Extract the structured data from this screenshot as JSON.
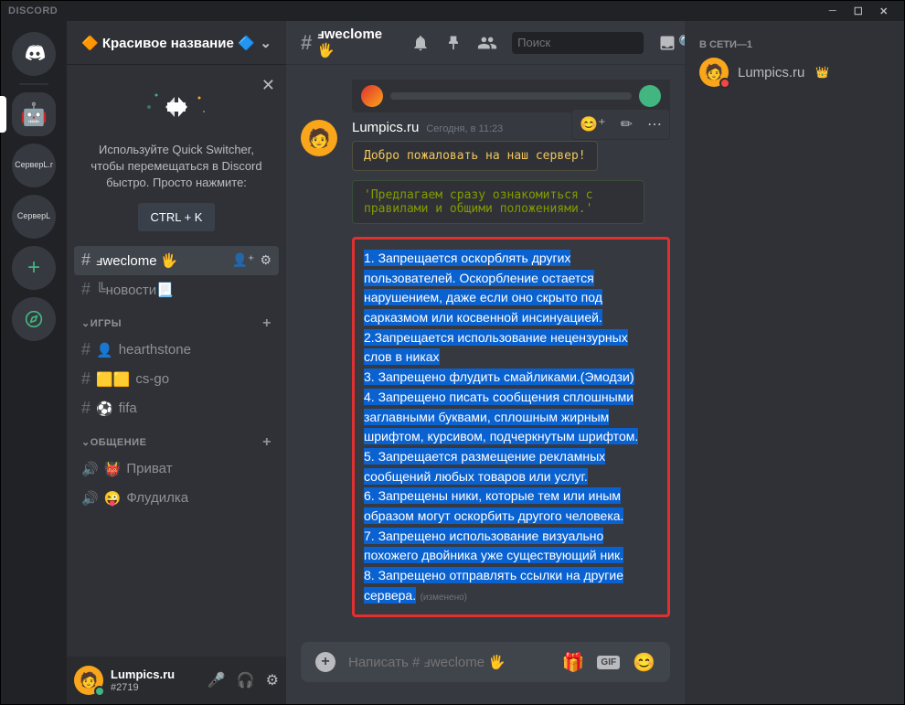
{
  "app_name": "DISCORD",
  "server_name": "🔶 Красивое название 🔷",
  "channel_header": "ⅎweclome 🖐",
  "quick_switcher": {
    "text": "Используйте Quick Switcher, чтобы перемещаться в Discord быстро. Просто нажмите:",
    "button": "CTRL + K"
  },
  "channels": {
    "top": [
      {
        "name": "ⅎweclome 🖐",
        "active": true
      },
      {
        "name": "╚новости📃",
        "active": false
      }
    ],
    "cat_games": "ИГРЫ",
    "games": [
      {
        "icon": "👤",
        "name": "hearthstone"
      },
      {
        "icon": "🟨🟨",
        "name": "cs-go"
      },
      {
        "icon": "⚽",
        "name": "fifa"
      }
    ],
    "cat_chat": "ОБЩЕНИЕ",
    "voice": [
      {
        "icon": "👹",
        "name": "Приват"
      },
      {
        "icon": "😜",
        "name": "Флудилка"
      }
    ]
  },
  "user": {
    "name": "Lumpics.ru",
    "tag": "#2719"
  },
  "search_placeholder": "Поиск",
  "message": {
    "author": "Lumpics.ru",
    "time": "Сегодня, в 11:23",
    "welcome": "Добро пожаловать на наш сервер!",
    "intro": "'Предлагаем сразу ознакомиться с правилами и общими положениями.'",
    "rules_text": "1. Запрещается оскорблять других пользователей. Оскорбление остается нарушением, даже если оно скрыто под сарказмом или косвенной инсинуацией.\n2.Запрещается использование нецензурных слов в никах\n3. Запрещено флудить смайликами.(Эмодзи)\n4. Запрещено писать сообщения сплошными заглавными буквами, сплошным жирным шрифтом, курсивом, подчеркнутым шрифтом.\n5. Запрещается размещение рекламных сообщений любых товаров или услуг.\n6. Запрещены ники, которые тем или иным образом могут оскорбить другого человека.\n7. Запрещено использование визуально похожего двойника уже существующий ник.\n8. Запрещено отправлять ссылки на другие сервера.",
    "edited": "(изменено)"
  },
  "input_placeholder": "Написать # ⅎweclome 🖐",
  "members_header": "В СЕТИ—1",
  "member_name": "Lumpics.ru"
}
